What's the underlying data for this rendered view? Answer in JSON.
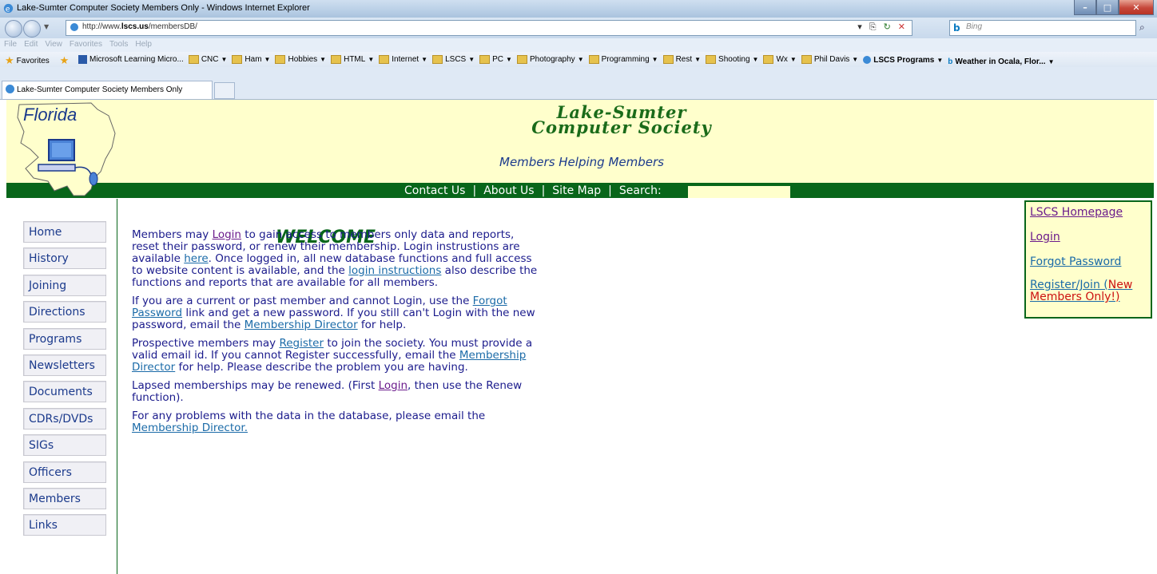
{
  "browser": {
    "window_title": "Lake-Sumter Computer Society Members Only - Windows Internet Explorer",
    "url_prefix": "http://www.",
    "url_domain": "lscs.us",
    "url_path": "/membersDB/",
    "search_placeholder": "Bing",
    "menu": [
      "File",
      "Edit",
      "View",
      "Favorites",
      "Tools",
      "Help"
    ],
    "favorites_label": "Favorites",
    "favorites_items": [
      {
        "label": "Microsoft Learning Micro...",
        "icon": "ms-icon",
        "dropdown": false
      },
      {
        "label": "CNC",
        "icon": "folder-icon",
        "dropdown": true
      },
      {
        "label": "Ham",
        "icon": "folder-icon",
        "dropdown": true
      },
      {
        "label": "Hobbies",
        "icon": "folder-icon",
        "dropdown": true
      },
      {
        "label": "HTML",
        "icon": "folder-icon",
        "dropdown": true
      },
      {
        "label": "Internet",
        "icon": "folder-icon",
        "dropdown": true
      },
      {
        "label": "LSCS",
        "icon": "folder-icon",
        "dropdown": true
      },
      {
        "label": "PC",
        "icon": "folder-icon",
        "dropdown": true
      },
      {
        "label": "Photography",
        "icon": "folder-icon",
        "dropdown": true
      },
      {
        "label": "Programming",
        "icon": "folder-icon",
        "dropdown": true
      },
      {
        "label": "Rest",
        "icon": "folder-icon",
        "dropdown": true
      },
      {
        "label": "Shooting",
        "icon": "folder-icon",
        "dropdown": true
      },
      {
        "label": "Wx",
        "icon": "folder-icon",
        "dropdown": true
      },
      {
        "label": "Phil Davis",
        "icon": "folder-icon",
        "dropdown": true
      },
      {
        "label": "LSCS Programs",
        "icon": "ie-page-icon",
        "dropdown": true,
        "bold": true
      },
      {
        "label": "Weather in Ocala, Flor...",
        "icon": "bing-icon",
        "dropdown": true,
        "bold": true
      }
    ],
    "tab_title": "Lake-Sumter Computer Society Members Only"
  },
  "header": {
    "map_label": "Florida",
    "site_title_line1": "Lake-Sumter",
    "site_title_line2": "Computer Society",
    "tagline": "Members Helping Members"
  },
  "topnav": {
    "contact": "Contact Us",
    "about": "About Us",
    "sitemap": "Site Map",
    "search_label": "Search:",
    "separator": "|"
  },
  "sidebar": {
    "items": [
      "Home",
      "History",
      "Joining",
      "Directions",
      "Programs",
      "Newsletters",
      "Documents",
      "CDRs/DVDs",
      "SIGs",
      "Officers",
      "Members",
      "Links"
    ]
  },
  "main": {
    "heading": "WELCOME",
    "p1": {
      "a": "Members may ",
      "login": "Login",
      "b": " to gain access to members only data and reports, reset their password, or renew their membership. Login instrustions are available ",
      "here": "here",
      "c": ". Once logged in, all new database functions and full access to website content is available, and the ",
      "instructions": "login instructions",
      "d": " also describe the functions and reports that are available for all members."
    },
    "p2": {
      "a": "If you are a current or past member and cannot Login, use the ",
      "forgot": "Forgot Password",
      "b": " link and get a new password. If you still can't Login with the new password, email the ",
      "director": "Membership Director",
      "c": " for help."
    },
    "p3": {
      "a": "Prospective members may ",
      "register": "Register",
      "b": " to join the society. You must provide a valid email id. If you cannot Register successfully, email the ",
      "director": "Membership Director",
      "c": " for help. Please describe the problem you are having."
    },
    "p4": {
      "a": "Lapsed memberships may be renewed. (First ",
      "login": "Login",
      "b": ", then use the Renew function)."
    },
    "p5": {
      "a": "For any problems with the data in the database, please email the ",
      "director": "Membership Director."
    }
  },
  "rightbox": {
    "homepage": "LSCS Homepage",
    "login": "Login",
    "forgot": "Forgot Password",
    "register": "Register/Join (",
    "register_new": "New Members Only!",
    "register_end": ")"
  },
  "colors": {
    "header_bg": "#ffffcc",
    "nav_green": "#08661a",
    "text_blue": "#1b1b8c",
    "visited_purple": "#6b1b8c",
    "link_blue": "#1b6ba8",
    "alert_red": "#cc1111"
  }
}
